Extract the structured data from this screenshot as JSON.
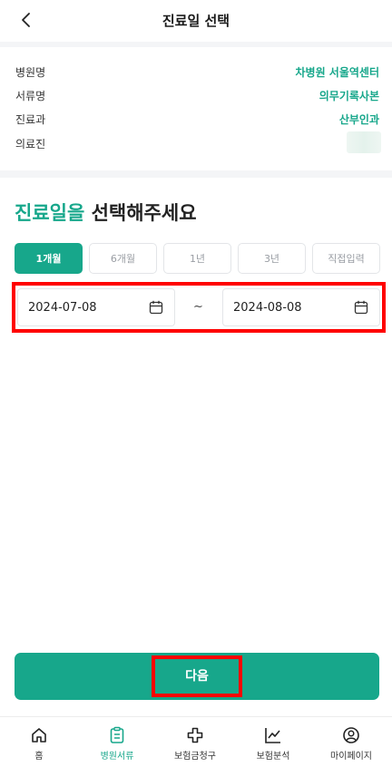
{
  "header": {
    "title": "진료일 선택"
  },
  "info": {
    "rows": [
      {
        "label": "병원명",
        "value": "차병원 서울역센터"
      },
      {
        "label": "서류명",
        "value": "의무기록사본"
      },
      {
        "label": "진료과",
        "value": "산부인과"
      },
      {
        "label": "의료진",
        "value": ""
      }
    ]
  },
  "prompt": {
    "accent": "진료일을",
    "rest": " 선택해주세요"
  },
  "periods": [
    {
      "label": "1개월",
      "active": true
    },
    {
      "label": "6개월",
      "active": false
    },
    {
      "label": "1년",
      "active": false
    },
    {
      "label": "3년",
      "active": false
    },
    {
      "label": "직접입력",
      "active": false
    }
  ],
  "date_range": {
    "start": "2024-07-08",
    "separator": "~",
    "end": "2024-08-08"
  },
  "next_button": {
    "label": "다음"
  },
  "nav": [
    {
      "label": "홈",
      "icon": "home-icon",
      "active": false
    },
    {
      "label": "병원서류",
      "icon": "clipboard-icon",
      "active": true
    },
    {
      "label": "보험금청구",
      "icon": "medical-cross-icon",
      "active": false
    },
    {
      "label": "보험분석",
      "icon": "chart-line-icon",
      "active": false
    },
    {
      "label": "마이페이지",
      "icon": "user-icon",
      "active": false
    }
  ],
  "colors": {
    "accent": "#17a78b",
    "highlight": "#ff0000",
    "background": "#f4f5f7"
  }
}
